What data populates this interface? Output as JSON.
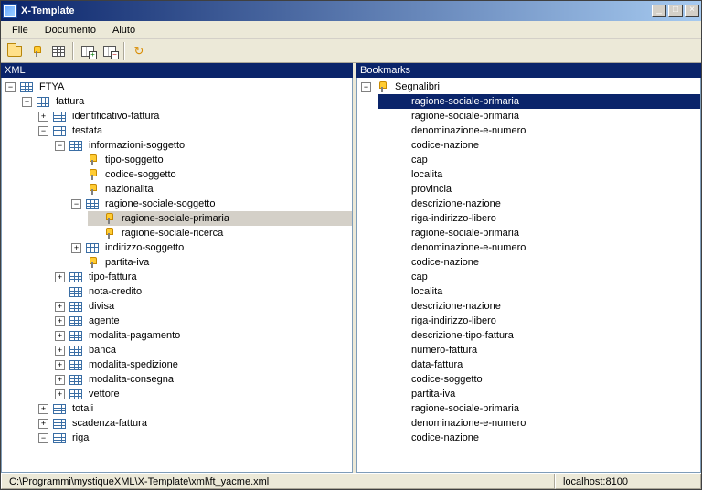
{
  "window": {
    "title": "X-Template"
  },
  "menu": {
    "file": "File",
    "doc": "Documento",
    "help": "Aiuto"
  },
  "panes": {
    "left_title": "XML",
    "right_title": "Bookmarks"
  },
  "status": {
    "path": "C:\\Programmi\\mystiqueXML\\X-Template\\xml\\ft_yacme.xml",
    "host": "localhost:8100"
  },
  "xml_tree": {
    "root": "FTYA",
    "fattura": "fattura",
    "identificativo": "identificativo-fattura",
    "testata": "testata",
    "info_soggetto": "informazioni-soggetto",
    "tipo_soggetto": "tipo-soggetto",
    "codice_soggetto": "codice-soggetto",
    "nazionalita": "nazionalita",
    "rag_soc_soggetto": "ragione-sociale-soggetto",
    "rag_soc_primaria": "ragione-sociale-primaria",
    "rag_soc_ricerca": "ragione-sociale-ricerca",
    "indirizzo_soggetto": "indirizzo-soggetto",
    "partita_iva": "partita-iva",
    "tipo_fattura": "tipo-fattura",
    "nota_credito": "nota-credito",
    "divisa": "divisa",
    "agente": "agente",
    "modalita_pagamento": "modalita-pagamento",
    "banca": "banca",
    "modalita_spedizione": "modalita-spedizione",
    "modalita_consegna": "modalita-consegna",
    "vettore": "vettore",
    "totali": "totali",
    "scadenza_fattura": "scadenza-fattura",
    "riga": "riga"
  },
  "bookmarks": {
    "root": "Segnalibri",
    "items": [
      "ragione-sociale-primaria",
      "ragione-sociale-primaria",
      "denominazione-e-numero",
      "codice-nazione",
      "cap",
      "localita",
      "provincia",
      "descrizione-nazione",
      "riga-indirizzo-libero",
      "ragione-sociale-primaria",
      "denominazione-e-numero",
      "codice-nazione",
      "cap",
      "localita",
      "descrizione-nazione",
      "riga-indirizzo-libero",
      "descrizione-tipo-fattura",
      "numero-fattura",
      "data-fattura",
      "codice-soggetto",
      "partita-iva",
      "ragione-sociale-primaria",
      "denominazione-e-numero",
      "codice-nazione"
    ],
    "selected_index": 0
  }
}
